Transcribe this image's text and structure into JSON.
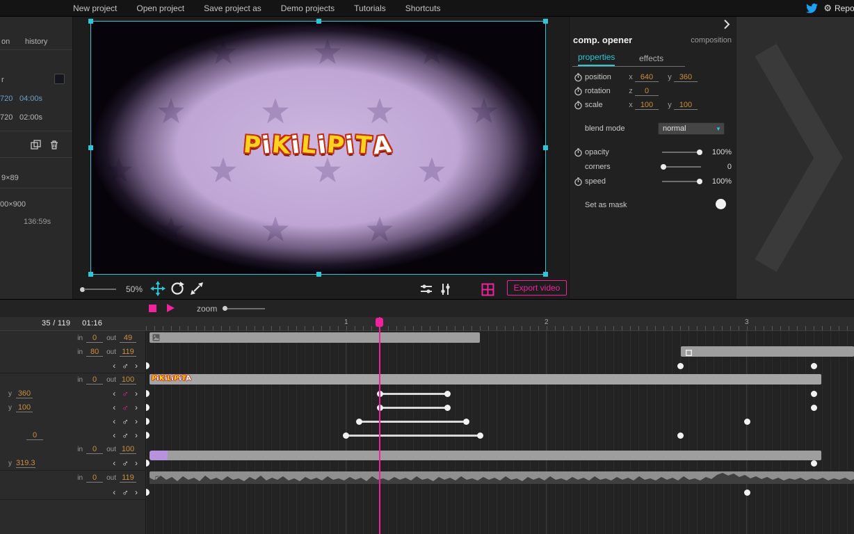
{
  "colors": {
    "cyan": "#2fc6d8",
    "magenta": "#f0239c",
    "orange": "#cd8e3e"
  },
  "menubar": {
    "items": [
      "New project",
      "Open project",
      "Save project as",
      "Demo projects",
      "Tutorials",
      "Shortcuts"
    ],
    "report_label": "Report"
  },
  "left_panel": {
    "tab_composition": "on",
    "tab_history": "history",
    "color_label": "r",
    "line1": {
      "size": "720",
      "time": "04:00s"
    },
    "line2": {
      "size": "720",
      "time": "02:00s"
    },
    "dim1": "9×89",
    "dim2": "00×900",
    "total_time": "136:59s"
  },
  "canvas": {
    "logo_text": "PiKiLiPiTA",
    "zoom_value": "50%",
    "export_label": "Export video"
  },
  "inspector": {
    "title": "comp. opener",
    "type_label": "composition",
    "tab_properties": "properties",
    "tab_effects": "effects",
    "position": {
      "label": "position",
      "x_label": "x",
      "x_value": "640",
      "y_label": "y",
      "y_value": "360"
    },
    "rotation": {
      "label": "rotation",
      "z_label": "z",
      "z_value": "0"
    },
    "scale": {
      "label": "scale",
      "x_label": "x",
      "x_value": "100",
      "y_label": "y",
      "y_value": "100"
    },
    "blend": {
      "label": "blend mode",
      "value": "normal"
    },
    "opacity": {
      "label": "opacity",
      "value": "100%"
    },
    "corners": {
      "label": "corners",
      "value": "0"
    },
    "speed": {
      "label": "speed",
      "value": "100%"
    },
    "mask": {
      "label": "Set as mask"
    }
  },
  "timeline": {
    "zoom_label": "zoom",
    "frame_counter": "35 / 119",
    "timecode": "01:16",
    "ruler": [
      "1",
      "2",
      "3"
    ],
    "rows": [
      {
        "in": "0",
        "out": "49"
      },
      {
        "in": "80",
        "out": "119"
      },
      {
        "in": "0",
        "out": "100"
      },
      {
        "param": "y",
        "value": "360"
      },
      {
        "param": "y",
        "value": "100"
      },
      {
        "value": "0"
      },
      {
        "in": "0",
        "out": "100"
      },
      {
        "param": "y",
        "value": "319.3"
      },
      {
        "in": "0",
        "out": "119"
      }
    ],
    "labels": {
      "in": "in",
      "out": "out"
    }
  }
}
